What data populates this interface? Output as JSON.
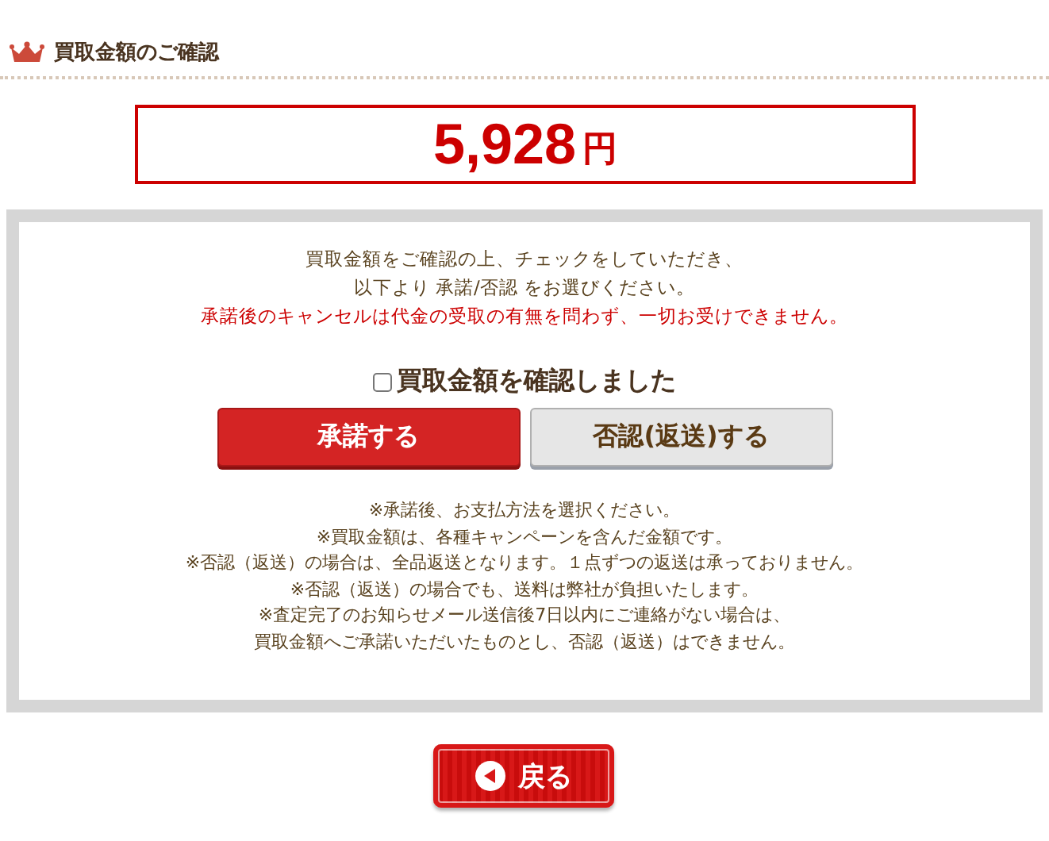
{
  "heading": {
    "title": "買取金額のご確認"
  },
  "amount": {
    "value": "5,928",
    "unit": "円"
  },
  "instructions": [
    "買取金額をご確認の上、チェックをしていただき、",
    "以下より 承諾/否認 をお選びください。"
  ],
  "warning": "承諾後のキャンセルは代金の受取の有無を問わず、一切お受けできません。",
  "confirm_checkbox": {
    "label": "買取金額を確認しました",
    "checked": false
  },
  "buttons": [
    {
      "label": "承諾する",
      "kind": "primary"
    },
    {
      "label": "否認(返送)する",
      "kind": "secondary"
    }
  ],
  "notes": [
    "※承諾後、お支払方法を選択ください。",
    "※買取金額は、各種キャンペーンを含んだ金額です。",
    "※否認（返送）の場合は、全品返送となります。１点ずつの返送は承っておりません。",
    "※否認（返送）の場合でも、送料は弊社が負担いたします。",
    "※査定完了のお知らせメール送信後7日以内にご連絡がない場合は、",
    "買取金額へご承諾いただいたものとし、否認（返送）はできません。"
  ],
  "back_button": {
    "label": "戻る"
  }
}
